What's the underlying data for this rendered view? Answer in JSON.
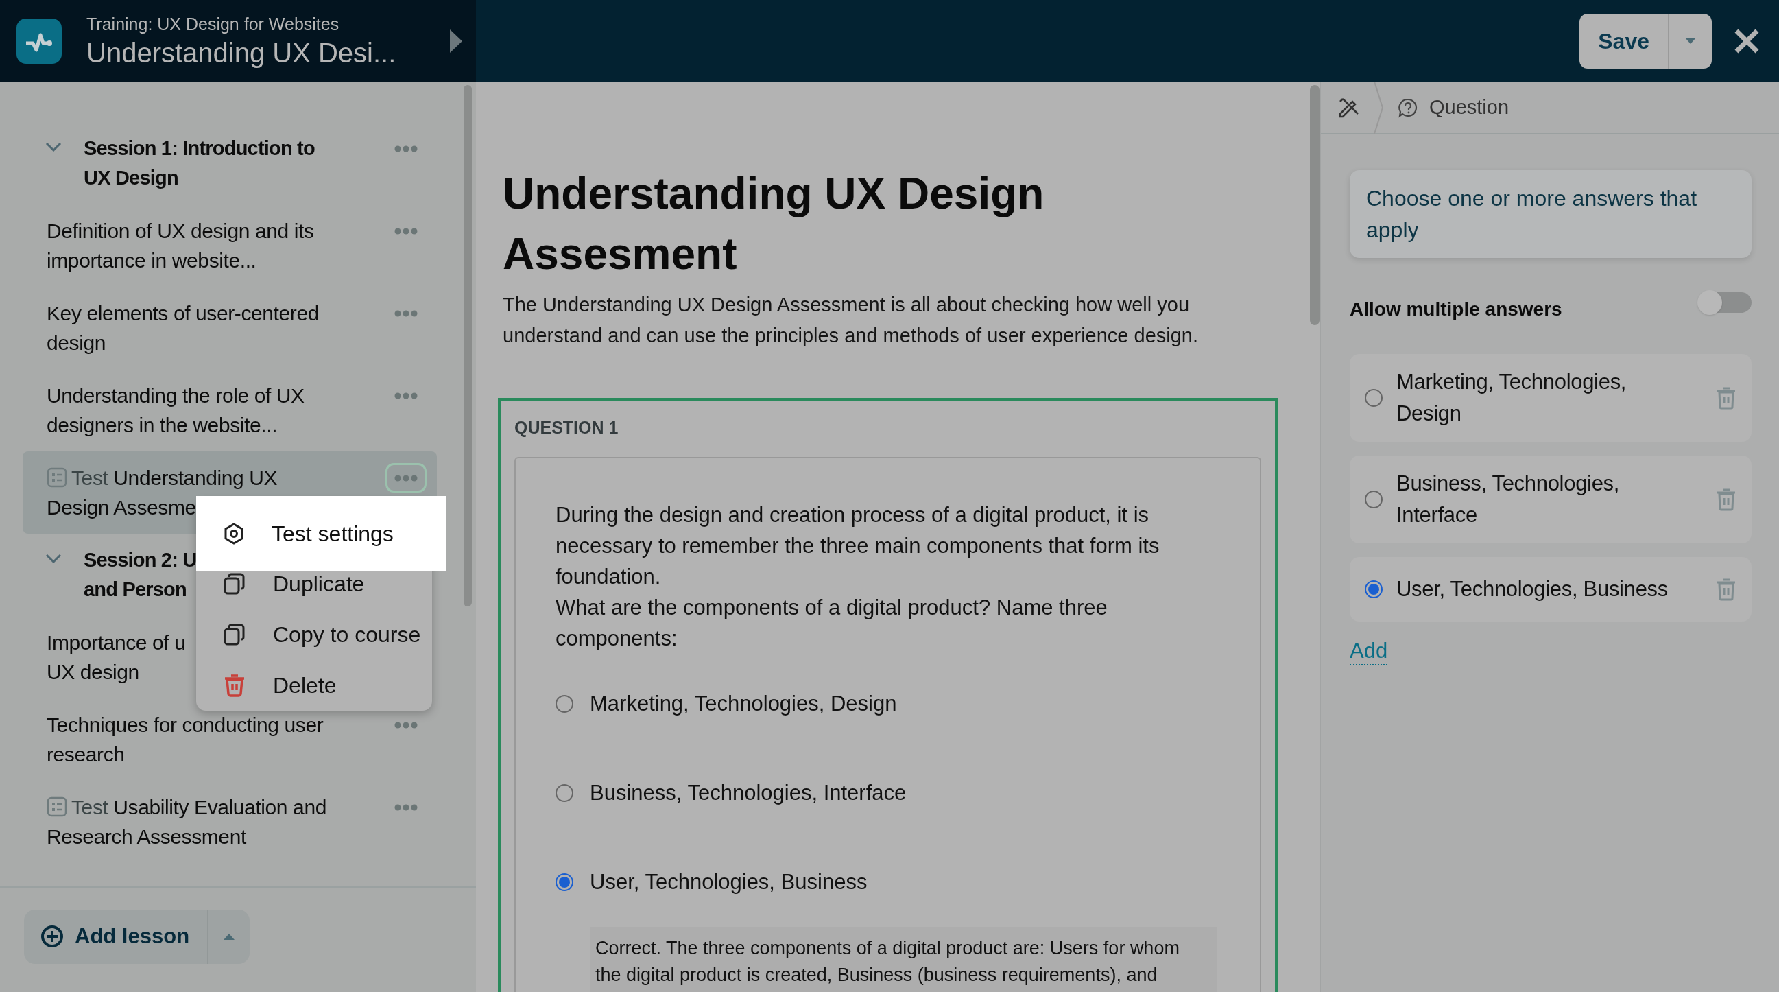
{
  "header": {
    "course": "Training: UX Design for Websites",
    "title": "Understanding UX Desi..."
  },
  "save_button": {
    "label": "Save"
  },
  "sidebar": {
    "items": [
      {
        "kind": "session",
        "lines": [
          "Session 1: Introduction to",
          "UX Design"
        ],
        "expanded": true,
        "selected": false,
        "more_button": true
      },
      {
        "kind": "lesson",
        "lines": [
          "Definition of UX design and its",
          "importance in website..."
        ],
        "selected": false,
        "more_button": true
      },
      {
        "kind": "lesson",
        "lines": [
          "Key elements of user-centered",
          "design"
        ],
        "selected": false,
        "more_button": true
      },
      {
        "kind": "lesson",
        "lines": [
          "Understanding the role of UX",
          "designers in the website..."
        ],
        "selected": false,
        "more_button": true
      },
      {
        "kind": "test",
        "prefix": "Test",
        "lines": [
          "Understanding UX",
          "Design Assesme"
        ],
        "selected": true,
        "more_button": true
      },
      {
        "kind": "session",
        "lines": [
          "Session 2: U",
          "and Person"
        ],
        "expanded": true,
        "selected": false,
        "more_button": false
      },
      {
        "kind": "lesson",
        "lines": [
          "Importance of u",
          "UX design"
        ],
        "selected": false,
        "more_button": false
      },
      {
        "kind": "lesson",
        "lines": [
          "Techniques for conducting user",
          "research"
        ],
        "selected": false,
        "more_button": true
      },
      {
        "kind": "test",
        "prefix": "Test",
        "lines": [
          "Usability Evaluation and",
          "Research Assessment"
        ],
        "selected": false,
        "more_button": true
      }
    ],
    "add_lesson": "Add lesson"
  },
  "context_menu": [
    {
      "kind": "settings",
      "label": "Test settings",
      "highlighted": true
    },
    {
      "kind": "duplicate",
      "label": "Duplicate",
      "highlighted": false
    },
    {
      "kind": "copy",
      "label": "Copy to course",
      "highlighted": false
    },
    {
      "kind": "delete",
      "label": "Delete",
      "highlighted": false
    }
  ],
  "content": {
    "title": "Understanding UX Design Assesment",
    "description": "The Understanding UX Design Assessment is all about checking how well you understand and can use the principles and methods of user experience design.",
    "question": {
      "label": "QUESTION 1",
      "paragraphs": [
        "During the design and creation process of a digital product, it is necessary to remember the three main components that form its foundation.",
        "What are the components of a digital product? Name three components:"
      ],
      "options": [
        {
          "label": "Marketing, Technologies, Design",
          "selected": false
        },
        {
          "label": "Business, Technologies, Interface",
          "selected": false
        },
        {
          "label": "User, Technologies, Business",
          "selected": true
        }
      ],
      "feedback_lines": [
        "Correct. The three components of a digital product are: Users for whom",
        "the digital product is created, Business (business requirements), and"
      ]
    }
  },
  "inspector": {
    "breadcrumb": "Question",
    "hint": "Choose one or more answers that apply",
    "toggle": {
      "label": "Allow multiple answers",
      "on": false
    },
    "answers": [
      {
        "label": "Marketing, Technologies, Design",
        "selected": false
      },
      {
        "label": "Business, Technologies, Interface",
        "selected": false
      },
      {
        "label": "User, Technologies, Business",
        "selected": true
      }
    ],
    "add_link": "Add"
  }
}
